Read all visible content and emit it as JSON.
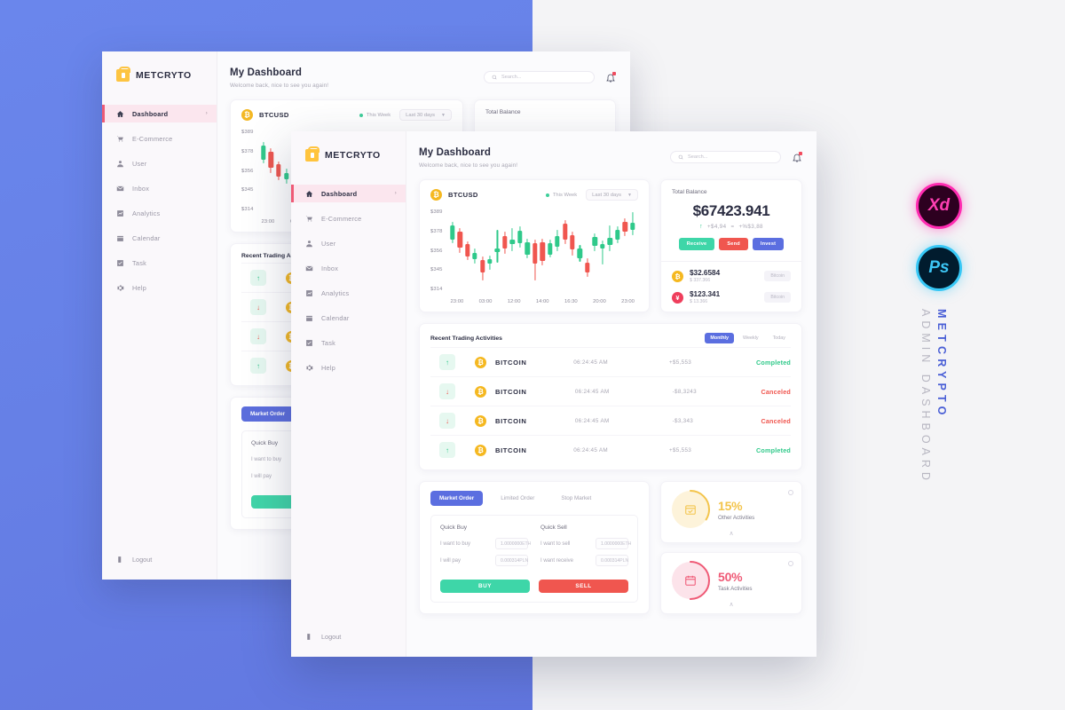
{
  "background": {
    "accent_blue": "#6782E8",
    "right_panel": "#F4F4F6"
  },
  "brand": {
    "name": "METCRYTO",
    "logo_icon": "bag-icon"
  },
  "sidebar": {
    "items": [
      {
        "label": "Dashboard",
        "icon": "home-icon",
        "active": true,
        "chevron": "›"
      },
      {
        "label": "E-Commerce",
        "icon": "cart-icon",
        "active": false
      },
      {
        "label": "User",
        "icon": "user-icon",
        "active": false
      },
      {
        "label": "Inbox",
        "icon": "inbox-icon",
        "active": false
      },
      {
        "label": "Analytics",
        "icon": "analytics-icon",
        "active": false
      },
      {
        "label": "Calendar",
        "icon": "calendar-icon",
        "active": false
      },
      {
        "label": "Task",
        "icon": "task-icon",
        "active": false
      },
      {
        "label": "Help",
        "icon": "gear-icon",
        "active": false
      }
    ],
    "logout": {
      "label": "Logout",
      "icon": "logout-icon"
    }
  },
  "header": {
    "title": "My Dashboard",
    "subtitle": "Welcome back, nice to see you again!",
    "search": {
      "placeholder": "Search...",
      "icon": "search-icon"
    },
    "notification": {
      "icon": "bell-icon",
      "has_badge": true
    }
  },
  "chart_card": {
    "coin_symbol": "₿",
    "coin_label": "BTCUSD",
    "legend": "This Week",
    "range_select": "Last 30 days"
  },
  "chart_data": {
    "type": "candlestick",
    "title": "BTCUSD",
    "xlabel": "",
    "ylabel": "",
    "ytick_labels": [
      "$389",
      "$378",
      "$356",
      "$345",
      "$314"
    ],
    "xtick_labels": [
      "23:00",
      "03:00",
      "12:00",
      "14:00",
      "16:30",
      "20:00",
      "23:00"
    ],
    "ylim": [
      305,
      396
    ],
    "legend": "This Week",
    "grid": false,
    "candles": [
      {
        "open": 362,
        "close": 377,
        "low": 358,
        "high": 381,
        "dir": "up"
      },
      {
        "open": 370,
        "close": 353,
        "low": 348,
        "high": 374,
        "dir": "down"
      },
      {
        "open": 357,
        "close": 344,
        "low": 340,
        "high": 360,
        "dir": "down"
      },
      {
        "open": 348,
        "close": 341,
        "low": 336,
        "high": 352,
        "dir": "up"
      },
      {
        "open": 340,
        "close": 327,
        "low": 318,
        "high": 344,
        "dir": "down"
      },
      {
        "open": 336,
        "close": 341,
        "low": 330,
        "high": 345,
        "dir": "up"
      },
      {
        "open": 349,
        "close": 352,
        "low": 337,
        "high": 372,
        "dir": "up"
      },
      {
        "open": 366,
        "close": 352,
        "low": 347,
        "high": 370,
        "dir": "down"
      },
      {
        "open": 357,
        "close": 362,
        "low": 350,
        "high": 374,
        "dir": "up"
      },
      {
        "open": 358,
        "close": 371,
        "low": 353,
        "high": 376,
        "dir": "up"
      },
      {
        "open": 346,
        "close": 359,
        "low": 342,
        "high": 363,
        "dir": "up"
      },
      {
        "open": 358,
        "close": 336,
        "low": 318,
        "high": 362,
        "dir": "down"
      },
      {
        "open": 359,
        "close": 339,
        "low": 334,
        "high": 363,
        "dir": "down"
      },
      {
        "open": 346,
        "close": 358,
        "low": 343,
        "high": 362,
        "dir": "up"
      },
      {
        "open": 354,
        "close": 366,
        "low": 350,
        "high": 372,
        "dir": "up"
      },
      {
        "open": 379,
        "close": 362,
        "low": 357,
        "high": 383,
        "dir": "down"
      },
      {
        "open": 367,
        "close": 351,
        "low": 345,
        "high": 370,
        "dir": "down"
      },
      {
        "open": 342,
        "close": 352,
        "low": 338,
        "high": 356,
        "dir": "up"
      },
      {
        "open": 337,
        "close": 327,
        "low": 322,
        "high": 342,
        "dir": "down"
      },
      {
        "open": 355,
        "close": 365,
        "low": 350,
        "high": 369,
        "dir": "up"
      },
      {
        "open": 352,
        "close": 357,
        "low": 335,
        "high": 361,
        "dir": "up"
      },
      {
        "open": 356,
        "close": 364,
        "low": 350,
        "high": 377,
        "dir": "up"
      },
      {
        "open": 362,
        "close": 372,
        "low": 358,
        "high": 376,
        "dir": "up"
      },
      {
        "open": 370,
        "close": 381,
        "low": 366,
        "high": 385,
        "dir": "down"
      },
      {
        "open": 372,
        "close": 380,
        "low": 367,
        "high": 391,
        "dir": "up"
      }
    ]
  },
  "balance": {
    "label": "Total Balance",
    "amount": "$67423.941",
    "delta_arrow": "↑",
    "delta_value": "+$4,94",
    "delta_separator": "=",
    "delta_percent": "+%$3,88",
    "actions": [
      {
        "label": "Receive",
        "color": "#3ED6A8"
      },
      {
        "label": "Send",
        "color": "#F0564F"
      },
      {
        "label": "Invest",
        "color": "#5B6EE0"
      }
    ],
    "coins": [
      {
        "symbol": "₿",
        "color": "#F5B820",
        "amount": "$32.6584",
        "sub": "$ 337.366",
        "tag": "Bitcoin"
      },
      {
        "symbol": "¥",
        "color": "#EF3E5C",
        "amount": "$123.341",
        "sub": "$ 13.366",
        "tag": "Bitcoin"
      }
    ]
  },
  "activities": {
    "title": "Recent Trading Activities",
    "tabs": [
      {
        "label": "Monthly",
        "active": true
      },
      {
        "label": "Weekly",
        "active": false
      },
      {
        "label": "Today",
        "active": false
      }
    ],
    "rows": [
      {
        "direction": "up",
        "coin_symbol": "₿",
        "name": "BITCOIN",
        "time": "06:24:45 AM",
        "amount": "+$5,553",
        "status": "Completed"
      },
      {
        "direction": "down",
        "coin_symbol": "₿",
        "name": "BITCOIN",
        "time": "06:24:45 AM",
        "amount": "-$8,3243",
        "status": "Canceled"
      },
      {
        "direction": "down",
        "coin_symbol": "₿",
        "name": "BITCOIN",
        "time": "06:24:45 AM",
        "amount": "-$3,343",
        "status": "Canceled"
      },
      {
        "direction": "up",
        "coin_symbol": "₿",
        "name": "BITCOIN",
        "time": "06:24:45 AM",
        "amount": "+$5,553",
        "status": "Completed"
      }
    ]
  },
  "order": {
    "tabs": [
      {
        "label": "Market Order",
        "active": true
      },
      {
        "label": "Limited Order",
        "active": false
      },
      {
        "label": "Stop Market",
        "active": false
      }
    ],
    "buy": {
      "title": "Quick Buy",
      "fields": [
        {
          "label": "I want to buy",
          "value": "1.0000000",
          "unit": "ETH"
        },
        {
          "label": "I will pay",
          "value": "0.000314",
          "unit": "PLN"
        }
      ],
      "button": "BUY"
    },
    "sell": {
      "title": "Quick Sell",
      "fields": [
        {
          "label": "I want to sell",
          "value": "1.0000000",
          "unit": "ETH"
        },
        {
          "label": "I want receive",
          "value": "0.000314",
          "unit": "PLN"
        }
      ],
      "button": "SELL"
    }
  },
  "stats": [
    {
      "percent": "15%",
      "label": "Other Activities",
      "color": "#F3C44B",
      "icon": "calendar-check-icon",
      "caret": "∧"
    },
    {
      "percent": "50%",
      "label": "Task Activities",
      "color": "#EF5A76",
      "icon": "calendar-icon",
      "caret": "∧"
    }
  ],
  "promo": {
    "badges": [
      {
        "label": "Xd",
        "name": "adobe-xd-badge"
      },
      {
        "label": "Ps",
        "name": "adobe-photoshop-badge"
      }
    ],
    "title": "METCRYPTO",
    "subtitle": "ADMIN DASHBOARD"
  }
}
